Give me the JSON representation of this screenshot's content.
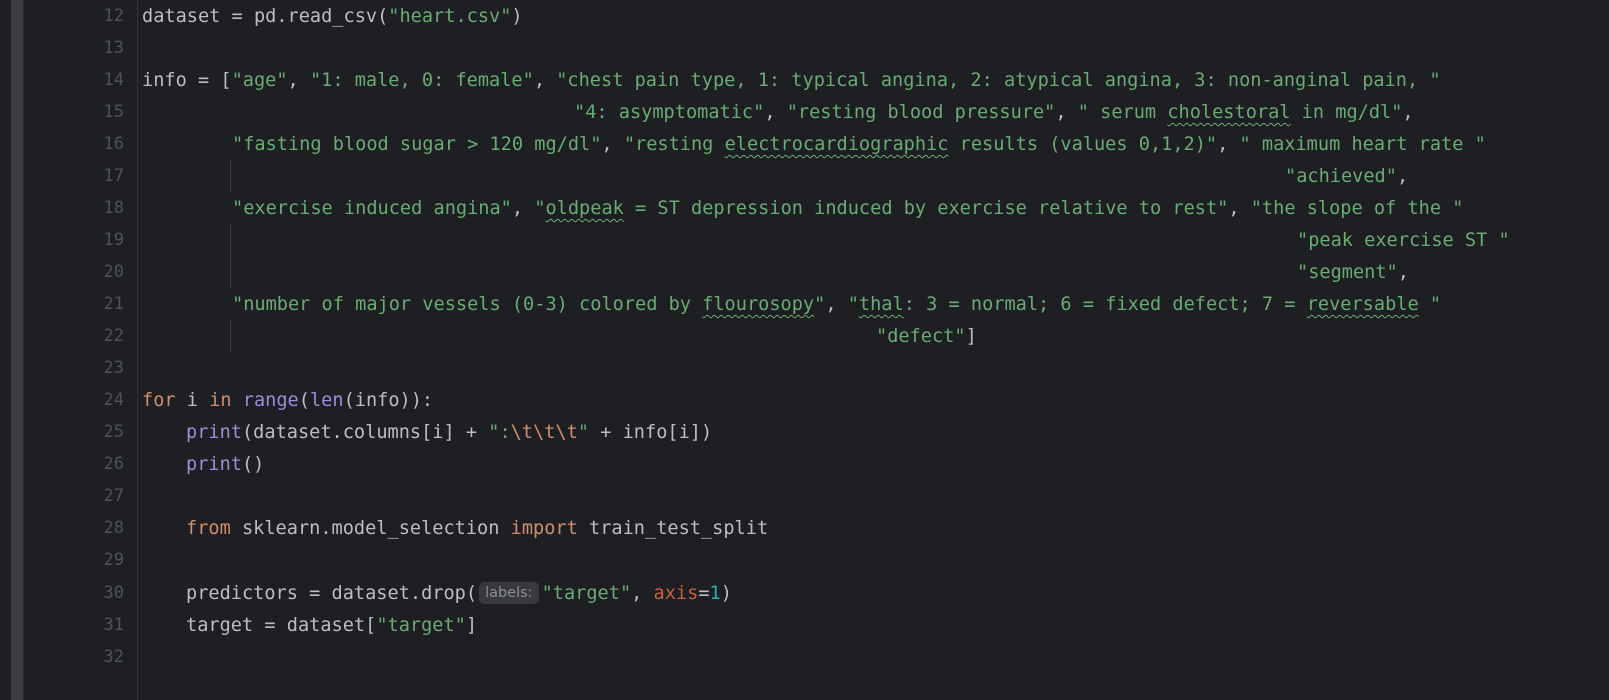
{
  "gutter": {
    "line_numbers": [
      "12",
      "13",
      "14",
      "15",
      "16",
      "17",
      "18",
      "19",
      "20",
      "21",
      "22",
      "23",
      "24",
      "25",
      "26",
      "27",
      "28",
      "29",
      "30",
      "31",
      "32"
    ]
  },
  "code": {
    "line12": {
      "a": "dataset = pd.read_csv(",
      "s1": "\"heart.csv\"",
      "b": ")"
    },
    "line14": {
      "a": "info = [",
      "s1": "\"age\"",
      "c1": ", ",
      "s2": "\"1: male, 0: female\"",
      "c2": ", ",
      "s3": "\"chest pain type, 1: typical angina, 2: atypical angina, 3: non-anginal pain, \""
    },
    "line15": {
      "s1": "\"4: asymptomatic\"",
      "c1": ", ",
      "s2": "\"resting blood pressure\"",
      "c2": ", ",
      "s3a": "\" serum ",
      "s3b": "cholestoral",
      "s3c": " in mg/dl\"",
      "c3": ","
    },
    "line16": {
      "s1": "\"fasting blood sugar > 120 mg/dl\"",
      "c1": ", ",
      "s2a": "\"resting ",
      "s2b": "electrocardiographic",
      "s2c": " results (values 0,1,2)\"",
      "c2": ", ",
      "s3": "\" maximum heart rate \""
    },
    "line17": {
      "s1": "\"achieved\"",
      "c1": ","
    },
    "line18": {
      "s1": "\"exercise induced angina\"",
      "c1": ", ",
      "s2a": "\"",
      "s2b": "oldpeak",
      "s2c": " = ST depression induced by exercise relative to rest\"",
      "c2": ", ",
      "s3": "\"the slope of the \""
    },
    "line19": {
      "s1": "\"peak exercise ST \""
    },
    "line20": {
      "s1": "\"segment\"",
      "c1": ","
    },
    "line21": {
      "s1a": "\"number of major vessels (0-3) colored by ",
      "s1b": "flourosopy",
      "s1c": "\"",
      "c1": ", ",
      "s2a": "\"",
      "s2b": "thal",
      "s2c": ": 3 = normal; 6 = fixed defect; 7 = ",
      "s2d": "reversable",
      "s2e": " \""
    },
    "line22": {
      "s1": "\"defect\"",
      "c1": "]"
    },
    "line24": {
      "kw1": "for",
      "t1": " i ",
      "kw2": "in",
      "t2": " ",
      "fn1": "range",
      "t3": "(",
      "fn2": "len",
      "t4": "(info)):"
    },
    "line25": {
      "fn1": "print",
      "t1": "(dataset.columns[i] + ",
      "s1": "\":",
      "e1": "\\t\\t\\t",
      "s2": "\"",
      "t2": " + info[i])"
    },
    "line26": {
      "fn1": "print",
      "t1": "()"
    },
    "line28": {
      "kw1": "from",
      "t1": " sklearn.model_selection ",
      "kw2": "import",
      "t2": " train_test_split"
    },
    "line30": {
      "t1": "predictors = dataset.drop(",
      "hint": "labels:",
      "s1": "\"target\"",
      "t2": ", ",
      "p1": "axis",
      "t3": "=",
      "n1": "1",
      "t4": ")"
    },
    "line31": {
      "t1": "target = dataset[",
      "s1": "\"target\"",
      "t2": "]"
    }
  }
}
